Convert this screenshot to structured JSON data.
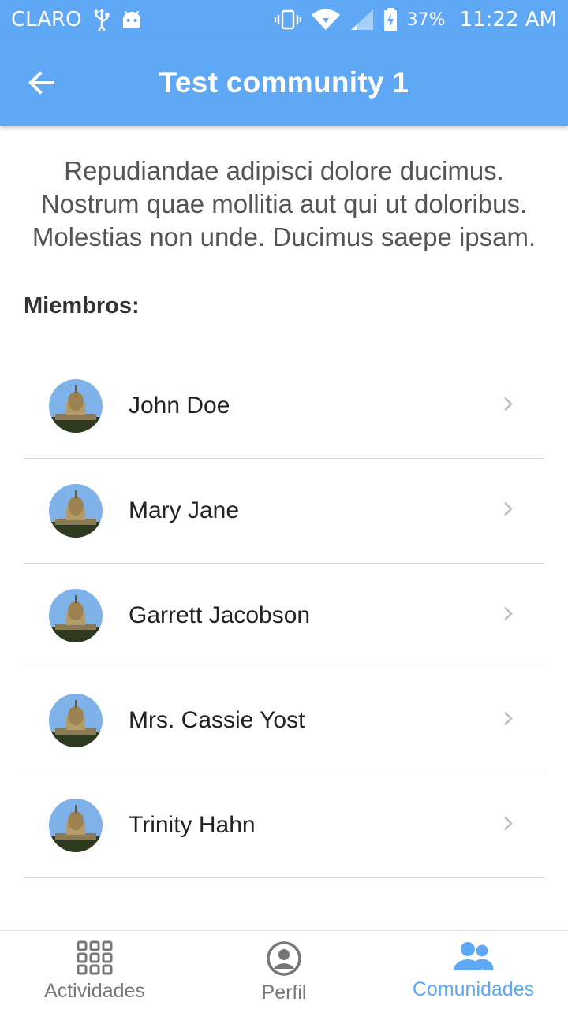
{
  "status_bar": {
    "carrier": "CLARO",
    "battery_percent": "37%",
    "time": "11:22 AM",
    "icons": [
      "usb-icon",
      "android-icon",
      "vibrate-icon",
      "wifi-icon",
      "signal-icon",
      "battery-charging-icon"
    ]
  },
  "header": {
    "title": "Test community 1",
    "back_icon": "arrow-back-icon"
  },
  "community": {
    "description": "Repudiandae adipisci dolore ducimus. Nostrum quae mollitia aut qui ut doloribus. Molestias non unde. Ducimus saepe ipsam.",
    "members_label": "Miembros:",
    "members": [
      {
        "name": "John Doe"
      },
      {
        "name": "Mary Jane"
      },
      {
        "name": "Garrett Jacobson"
      },
      {
        "name": "Mrs. Cassie Yost"
      },
      {
        "name": "Trinity Hahn"
      }
    ]
  },
  "bottom_nav": {
    "tabs": [
      {
        "label": "Actividades",
        "icon": "grid-icon",
        "active": false
      },
      {
        "label": "Perfil",
        "icon": "account-circle-icon",
        "active": false
      },
      {
        "label": "Comunidades",
        "icon": "group-icon",
        "active": true
      }
    ]
  },
  "colors": {
    "primary": "#5ea8f5",
    "text": "#222222",
    "muted": "#777777"
  }
}
